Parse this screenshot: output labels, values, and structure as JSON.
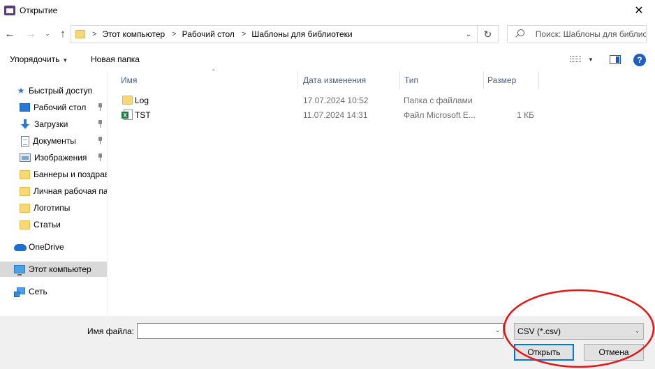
{
  "window": {
    "title": "Открытие",
    "close_glyph": "✕"
  },
  "nav": {
    "back_glyph": "←",
    "forward_glyph": "→",
    "recent_glyph": "⌄",
    "up_glyph": "↑",
    "breadcrumbs": [
      "Этот компьютер",
      "Рабочий стол",
      "Шаблоны для библиотеки"
    ],
    "crumb_sep": ">",
    "dropdown_glyph": "⌄",
    "refresh_glyph": "↻",
    "search_placeholder": "Поиск: Шаблоны для библиотеки"
  },
  "toolbar": {
    "organize_label": "Упорядочить",
    "caret": "▼",
    "new_folder_label": "Новая папка",
    "help_glyph": "?"
  },
  "sidebar": {
    "items": [
      {
        "label": "Быстрый доступ",
        "icon": "star-icon",
        "pinned": false
      },
      {
        "label": "Рабочий стол",
        "icon": "desktop-icon",
        "pinned": true
      },
      {
        "label": "Загрузки",
        "icon": "download-icon",
        "pinned": true
      },
      {
        "label": "Документы",
        "icon": "documents-icon",
        "pinned": true
      },
      {
        "label": "Изображения",
        "icon": "pictures-icon",
        "pinned": true
      },
      {
        "label": "Баннеры и поздрав",
        "icon": "folder-icon",
        "pinned": false
      },
      {
        "label": "Личная рабочая па",
        "icon": "folder-icon",
        "pinned": false
      },
      {
        "label": "Логотипы",
        "icon": "folder-icon",
        "pinned": false
      },
      {
        "label": "Статьи",
        "icon": "folder-icon",
        "pinned": false
      },
      {
        "label": "OneDrive",
        "icon": "onedrive-icon",
        "pinned": false
      },
      {
        "label": "Этот компьютер",
        "icon": "computer-icon",
        "pinned": false,
        "selected": true
      },
      {
        "label": "Сеть",
        "icon": "network-icon",
        "pinned": false
      }
    ],
    "star_glyph": "★"
  },
  "filelist": {
    "columns": [
      "Имя",
      "Дата изменения",
      "Тип",
      "Размер"
    ],
    "sort_glyph": "^",
    "rows": [
      {
        "name": "Log",
        "date": "17.07.2024 10:52",
        "type": "Папка с файлами",
        "size": "",
        "icon": "folder-icon"
      },
      {
        "name": "TST",
        "date": "11.07.2024 14:31",
        "type": "Файл Microsoft E...",
        "size": "1 КБ",
        "icon": "excel-file-icon"
      }
    ]
  },
  "bottom": {
    "filename_label": "Имя файла:",
    "filename_value": "",
    "filter_value": "CSV (*.csv)",
    "caret": "⌄",
    "open_label": "Открыть",
    "cancel_label": "Отмена"
  },
  "colors": {
    "annotation": "#e01818",
    "accent": "#0078d7"
  }
}
